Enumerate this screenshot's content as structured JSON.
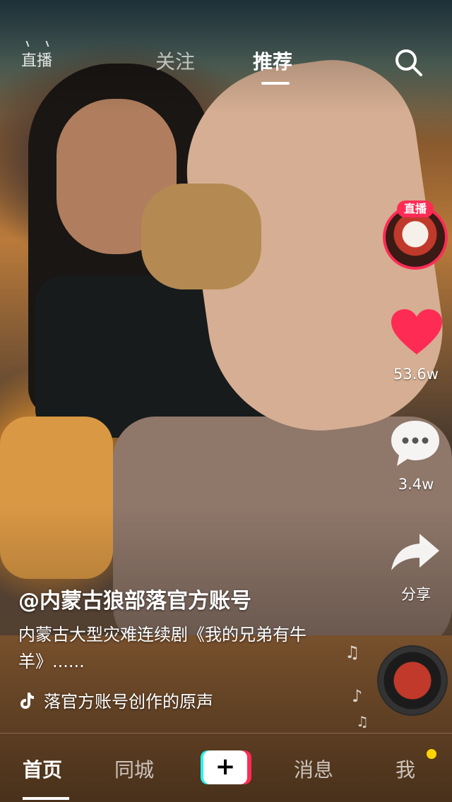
{
  "topnav": {
    "live": "直播",
    "follow": "关注",
    "recommend": "推荐"
  },
  "rail": {
    "live_badge": "直播",
    "like_count": "53.6w",
    "comment_count": "3.4w",
    "share_label": "分享"
  },
  "caption": {
    "author": "@内蒙古狼部落官方账号",
    "description": "内蒙古大型灾难连续剧《我的兄弟有牛羊》......",
    "music": "落官方账号创作的原声"
  },
  "bottombar": {
    "home": "首页",
    "city": "同城",
    "plus": "+",
    "messages": "消息",
    "me": "我"
  },
  "colors": {
    "accent": "#fe2c55",
    "cyan": "#25f4ee",
    "notification_dot": "#ffd400"
  }
}
